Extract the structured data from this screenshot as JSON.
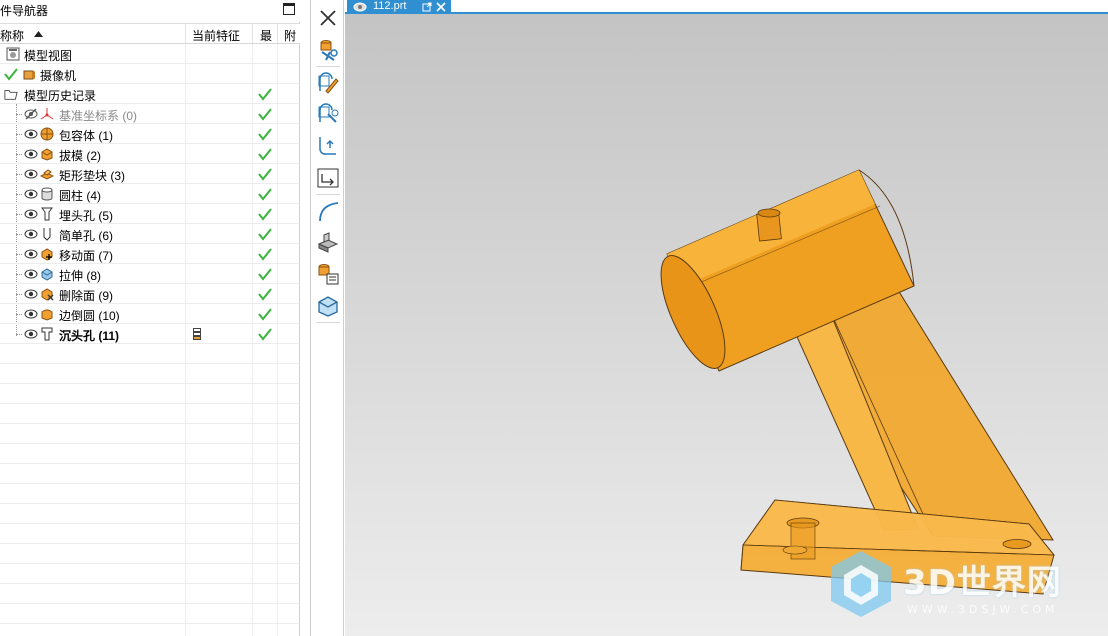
{
  "navigator": {
    "title": "件导航器",
    "columns": {
      "name": "称称",
      "current_feature": "当前特征",
      "latest": "最",
      "attached": "附"
    },
    "rows": [
      {
        "label": "模型视图",
        "icon": "model-views-icon"
      },
      {
        "label": "摄像机",
        "icon": "camera-icon",
        "checked_left": true
      },
      {
        "label": "模型历史记录",
        "icon": "folder-icon"
      },
      {
        "label": "基准坐标系 (0)",
        "icon": "datum-csys-icon",
        "dim": true,
        "check": true
      },
      {
        "label": "包容体 (1)",
        "icon": "bounding-body-icon",
        "check": true
      },
      {
        "label": "拔模 (2)",
        "icon": "draft-icon",
        "check": true
      },
      {
        "label": "矩形垫块 (3)",
        "icon": "rect-pad-icon",
        "check": true
      },
      {
        "label": "圆柱 (4)",
        "icon": "cylinder-icon",
        "check": true
      },
      {
        "label": "埋头孔 (5)",
        "icon": "countersunk-hole-icon",
        "check": true
      },
      {
        "label": "简单孔 (6)",
        "icon": "simple-hole-icon",
        "check": true
      },
      {
        "label": "移动面 (7)",
        "icon": "move-face-icon",
        "check": true
      },
      {
        "label": "拉伸 (8)",
        "icon": "extrude-icon",
        "check": true
      },
      {
        "label": "删除面 (9)",
        "icon": "delete-face-icon",
        "check": true
      },
      {
        "label": "边倒圆 (10)",
        "icon": "edge-blend-icon",
        "check": true
      },
      {
        "label": "沉头孔 (11)",
        "icon": "counterbore-hole-icon",
        "check": true,
        "bold": true,
        "current": true
      }
    ]
  },
  "document": {
    "tab_label": "112.prt"
  },
  "watermark": {
    "text": "3D世界网",
    "url": "WWW.3DSJW.COM"
  },
  "colors": {
    "accent": "#2f8fd0",
    "part": "#f5a623",
    "check": "#3cb43c"
  }
}
